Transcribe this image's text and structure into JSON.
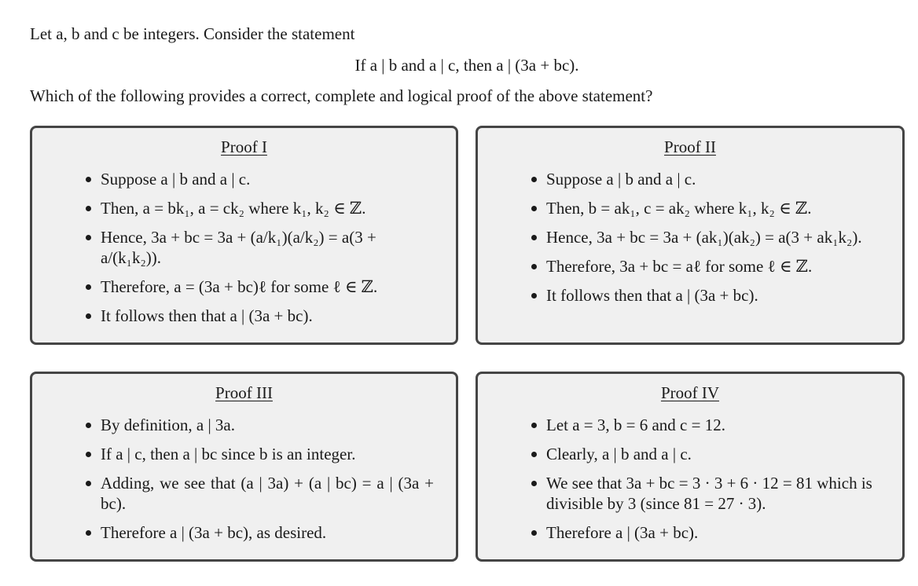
{
  "intro": "Let a, b and c be integers. Consider the statement",
  "statement": "If a | b and a | c, then a | (3a + bc).",
  "question": "Which of the following provides a correct, complete and logical proof of the above statement?",
  "proofs": [
    {
      "title": "Proof I",
      "steps": [
        "Suppose a | b and a | c.",
        "Then, a = bk₁, a = ck₂ where k₁, k₂ ∈ ℤ.",
        "Hence, 3a + bc = 3a + (a/k₁)(a/k₂) = a(3 + a/(k₁k₂)).",
        "Therefore, a = (3a + bc)ℓ for some ℓ ∈ ℤ.",
        "It follows then that a | (3a + bc)."
      ]
    },
    {
      "title": "Proof II",
      "steps": [
        "Suppose a | b and a | c.",
        "Then, b = ak₁, c = ak₂ where k₁, k₂ ∈ ℤ.",
        "Hence, 3a + bc = 3a + (ak₁)(ak₂) = a(3 + ak₁k₂).",
        "Therefore, 3a + bc = aℓ for some ℓ ∈ ℤ.",
        "It follows then that a | (3a + bc)."
      ]
    },
    {
      "title": "Proof III",
      "steps": [
        "By definition, a | 3a.",
        "If a | c, then a | bc since b is an integer.",
        "Adding, we see that (a | 3a) + (a | bc) = a | (3a + bc).",
        "Therefore a | (3a + bc), as desired."
      ]
    },
    {
      "title": "Proof IV",
      "steps": [
        "Let a = 3, b = 6 and c = 12.",
        "Clearly, a | b and a | c.",
        "We see that 3a + bc = 3 · 3 + 6 · 12 = 81 which is divisible by 3 (since 81 = 27 · 3).",
        "Therefore a | (3a + bc)."
      ]
    }
  ]
}
